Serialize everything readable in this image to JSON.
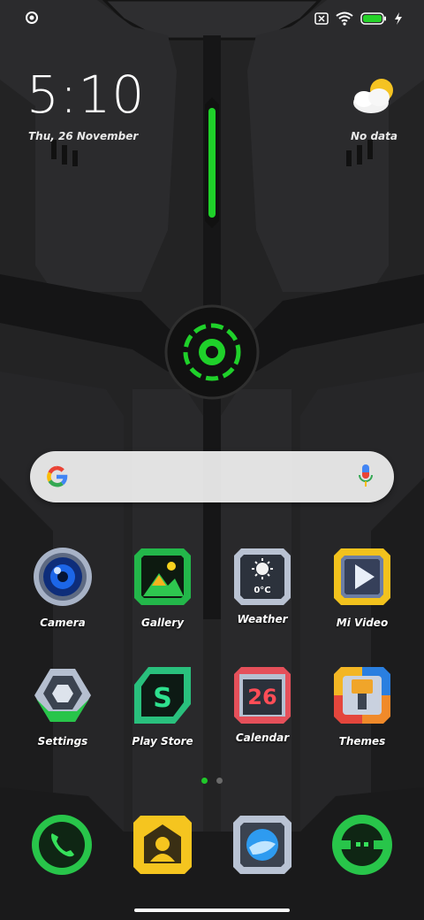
{
  "status_bar": {
    "icons": [
      "circle-status-icon",
      "sim-off-icon",
      "wifi-icon",
      "battery-icon",
      "charging-icon"
    ],
    "battery_color": "#27d32a"
  },
  "lockscreen": {
    "time": "5:10",
    "date": "Thu, 26 November",
    "weather_text": "No data"
  },
  "search": {
    "icons": [
      "google-icon",
      "mic-icon"
    ]
  },
  "apps": [
    {
      "label": "Camera"
    },
    {
      "label": "Gallery"
    },
    {
      "label": "Weather",
      "temp": "0°C"
    },
    {
      "label": "Mi Video"
    },
    {
      "label": "Settings"
    },
    {
      "label": "Play Store"
    },
    {
      "label": "Calendar",
      "day": "26"
    },
    {
      "label": "Themes"
    }
  ],
  "dock": [
    {
      "icon": "phone-icon"
    },
    {
      "icon": "contacts-icon"
    },
    {
      "icon": "browser-icon"
    },
    {
      "icon": "messages-icon"
    }
  ],
  "page_indicator": {
    "count": 2,
    "active": 1,
    "active_color": "#20c82a"
  },
  "accent": "#1fd12a"
}
